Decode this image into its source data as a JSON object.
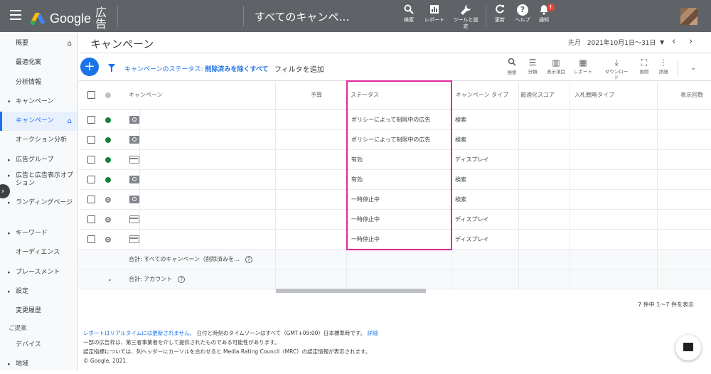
{
  "topbar": {
    "brand": "Google",
    "brand_suffix": "広告",
    "page_title": "すべてのキャンペ…",
    "tools": [
      {
        "label": "検索",
        "icon": "search-icon"
      },
      {
        "label": "レポート",
        "icon": "report-icon"
      },
      {
        "label": "ツールと設定",
        "icon": "wrench-icon"
      },
      {
        "label": "更新",
        "icon": "refresh-icon"
      },
      {
        "label": "ヘルプ",
        "icon": "help-icon"
      },
      {
        "label": "通知",
        "icon": "bell-icon",
        "badge": "!"
      }
    ]
  },
  "sidebar": {
    "items": [
      {
        "label": "概要"
      },
      {
        "label": "最適化案"
      },
      {
        "label": "分析情報"
      },
      {
        "label": "キャンペーン"
      },
      {
        "label": "キャンペーン"
      },
      {
        "label": "オークション分析"
      },
      {
        "label": "広告グループ"
      },
      {
        "label": "広告と広告表示オプション"
      },
      {
        "label": "ランディングページ"
      },
      {
        "label": "キーワード"
      },
      {
        "label": "オーディエンス"
      },
      {
        "label": "プレースメント"
      },
      {
        "label": "設定"
      },
      {
        "label": "変更履歴"
      },
      {
        "label": "ご提案"
      },
      {
        "label": "デバイス"
      },
      {
        "label": "地域"
      }
    ]
  },
  "header": {
    "title": "キャンペーン",
    "date_prefix": "先月",
    "date_range": "2021年10月1日〜31日"
  },
  "filterbar": {
    "filter_label": "キャンペーンのステータス:",
    "filter_value": "削除済みを除くすべて",
    "add_filter": "フィルタを追加",
    "tools": [
      {
        "label": "検索",
        "icon": "search-icon"
      },
      {
        "label": "分類",
        "icon": "segment-icon"
      },
      {
        "label": "表示項目",
        "icon": "columns-icon"
      },
      {
        "label": "レポート",
        "icon": "report-icon"
      },
      {
        "label": "ダウンロード",
        "icon": "download-icon"
      },
      {
        "label": "展開",
        "icon": "expand-icon"
      },
      {
        "label": "詳細",
        "icon": "more-icon"
      }
    ]
  },
  "table": {
    "columns": [
      "キャンペーン",
      "予算",
      "ステータス",
      "キャンペーン タイプ",
      "最適化スコア",
      "入札戦略タイプ",
      "表示回数"
    ],
    "rows": [
      {
        "status": "ポリシーによって制限中の広告",
        "type": "検索",
        "state": "enabled",
        "icon": "search"
      },
      {
        "status": "ポリシーによって制限中の広告",
        "type": "検索",
        "state": "enabled",
        "icon": "search"
      },
      {
        "status": "有効",
        "type": "ディスプレイ",
        "state": "enabled",
        "icon": "display"
      },
      {
        "status": "有効",
        "type": "検索",
        "state": "enabled",
        "icon": "search"
      },
      {
        "status": "一時停止中",
        "type": "検索",
        "state": "paused",
        "icon": "search"
      },
      {
        "status": "一時停止中",
        "type": "ディスプレイ",
        "state": "paused",
        "icon": "display"
      },
      {
        "status": "一時停止中",
        "type": "ディスプレイ",
        "state": "paused",
        "icon": "display"
      }
    ],
    "total_all": "合計: すべてのキャンペーン（削除済みを…",
    "total_account": "合計: アカウント",
    "pager": "7 件中 1〜7 件を表示"
  },
  "footer": {
    "link": "レポートはリアルタイムには更新されません。",
    "line1": "日付と時刻のタイムゾーンはすべて（GMT+09:00）日本標準時です。",
    "detail_link": "詳細",
    "line2": "一部の広告枠は、第三者事業者を介して提供されたものである可能性があります。",
    "line3": "認定指標については、列ヘッダーにカーソルを合わせると Media Rating Council（MRC）の認定情報が表示されます。",
    "copyright": "© Google, 2021."
  },
  "colors": {
    "topbar": "#5f6368",
    "accent": "#1a73e8",
    "highlight": "#e0289b",
    "enabled": "#188038"
  }
}
